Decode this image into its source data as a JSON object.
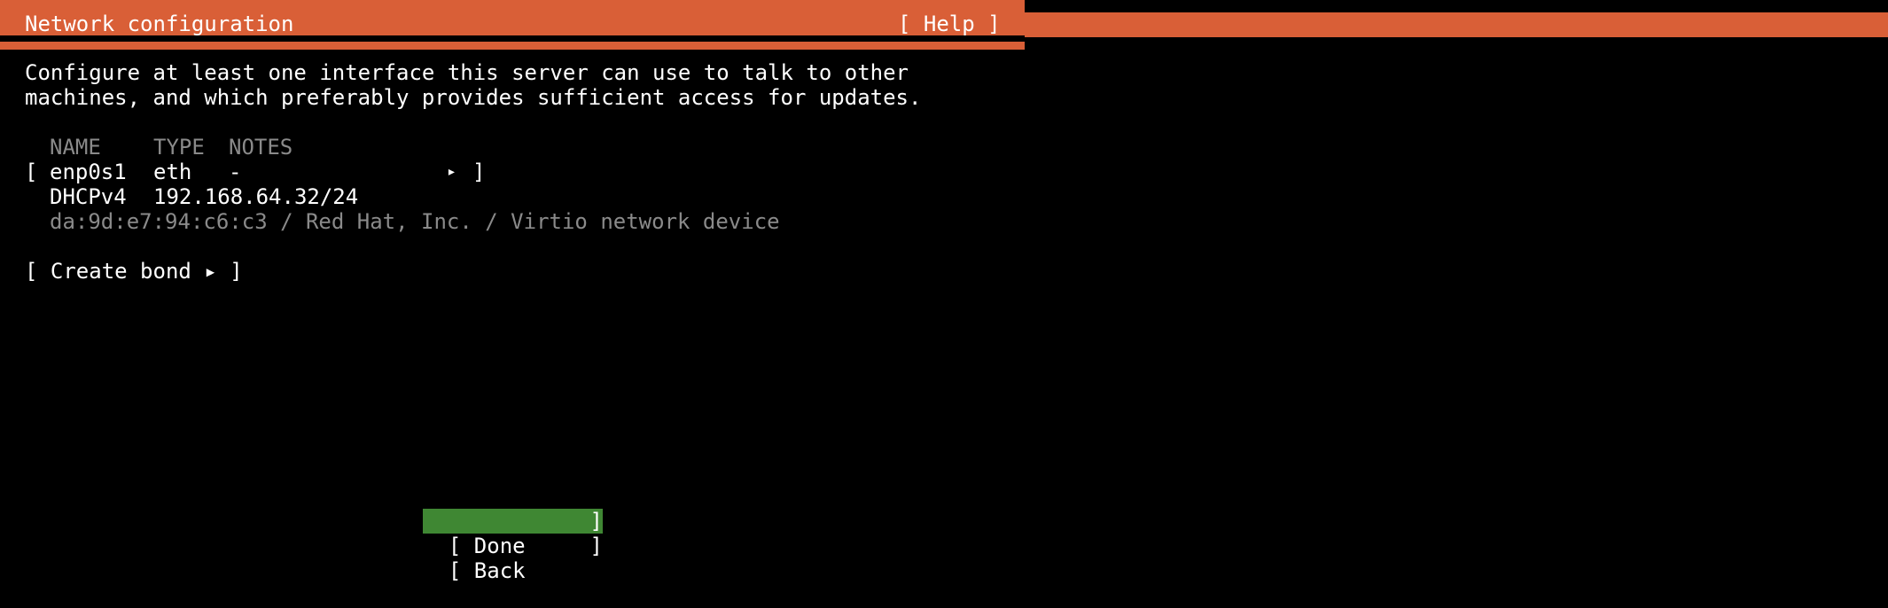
{
  "header": {
    "title": "Network configuration",
    "help_label": "[ Help ]",
    "accent_color": "#d95f37"
  },
  "intro": {
    "line1": "Configure at least one interface this server can use to talk to other",
    "line2": "machines, and which preferably provides sufficient access for updates."
  },
  "table": {
    "columns": [
      "NAME",
      "TYPE",
      "NOTES"
    ],
    "interfaces": [
      {
        "open_bracket": "[",
        "name": "enp0s1",
        "type": "eth",
        "notes": "-",
        "menu_glyph": "▸",
        "close_bracket": "]",
        "address_type": "DHCPv4",
        "address": "192.168.64.32/24",
        "hardware_info": "da:9d:e7:94:c6:c3 / Red Hat, Inc. / Virtio network device"
      }
    ]
  },
  "actions": {
    "create_bond_label": "[ Create bond ▸ ]"
  },
  "buttons": {
    "done_label": "[ Done",
    "back_label": "[ Back",
    "close_bracket": "]",
    "done_color": "#3f8733"
  }
}
